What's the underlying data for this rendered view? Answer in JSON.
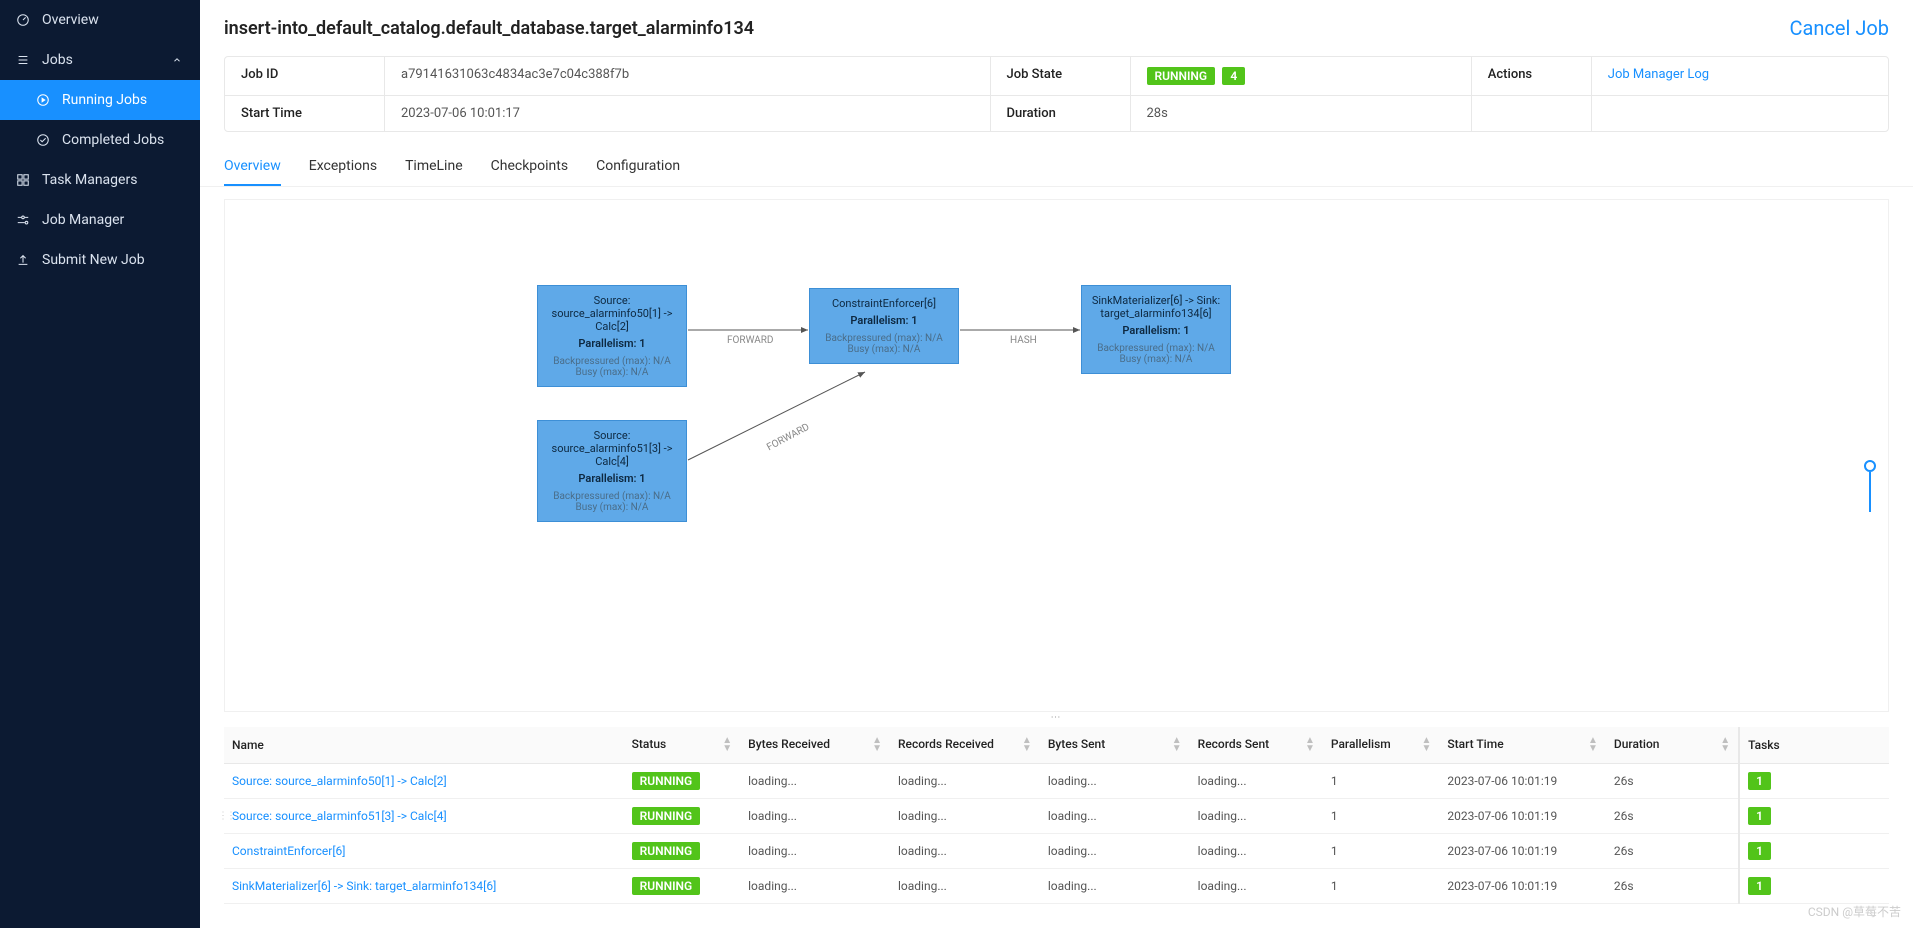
{
  "sidebar": {
    "overview": "Overview",
    "jobs": "Jobs",
    "running_jobs": "Running Jobs",
    "completed_jobs": "Completed Jobs",
    "task_managers": "Task Managers",
    "job_manager": "Job Manager",
    "submit_new_job": "Submit New Job"
  },
  "header": {
    "title": "insert-into_default_catalog.default_database.target_alarminfo134",
    "cancel": "Cancel Job"
  },
  "info": {
    "job_id_label": "Job ID",
    "job_id_value": "a79141631063c4834ac3e7c04c388f7b",
    "job_state_label": "Job State",
    "job_state_value": "RUNNING",
    "job_state_count": "4",
    "actions_label": "Actions",
    "actions_link": "Job Manager Log",
    "start_time_label": "Start Time",
    "start_time_value": "2023-07-06 10:01:17",
    "duration_label": "Duration",
    "duration_value": "28s"
  },
  "tabs": {
    "overview": "Overview",
    "exceptions": "Exceptions",
    "timeline": "TimeLine",
    "checkpoints": "Checkpoints",
    "configuration": "Configuration"
  },
  "graph": {
    "nodes": [
      {
        "title": "Source: source_alarminfo50[1] -> Calc[2]",
        "par": "Parallelism: 1",
        "bp": "Backpressured (max): N/A",
        "busy": "Busy (max): N/A"
      },
      {
        "title": "Source: source_alarminfo51[3] -> Calc[4]",
        "par": "Parallelism: 1",
        "bp": "Backpressured (max): N/A",
        "busy": "Busy (max): N/A"
      },
      {
        "title": "ConstraintEnforcer[6]",
        "par": "Parallelism: 1",
        "bp": "Backpressured (max): N/A",
        "busy": "Busy (max): N/A"
      },
      {
        "title": "SinkMaterializer[6] -> Sink: target_alarminfo134[6]",
        "par": "Parallelism: 1",
        "bp": "Backpressured (max): N/A",
        "busy": "Busy (max): N/A"
      }
    ],
    "edge1": "FORWARD",
    "edge2": "FORWARD",
    "edge3": "HASH"
  },
  "columns": {
    "name": "Name",
    "status": "Status",
    "bytes_received": "Bytes Received",
    "records_received": "Records Received",
    "bytes_sent": "Bytes Sent",
    "records_sent": "Records Sent",
    "parallelism": "Parallelism",
    "start_time": "Start Time",
    "duration": "Duration",
    "tasks": "Tasks"
  },
  "rows": [
    {
      "name": "Source: source_alarminfo50[1] -> Calc[2]",
      "status": "RUNNING",
      "br": "loading...",
      "rr": "loading...",
      "bs": "loading...",
      "rs": "loading...",
      "par": "1",
      "st": "2023-07-06 10:01:19",
      "dur": "26s",
      "tasks": "1"
    },
    {
      "name": "Source: source_alarminfo51[3] -> Calc[4]",
      "status": "RUNNING",
      "br": "loading...",
      "rr": "loading...",
      "bs": "loading...",
      "rs": "loading...",
      "par": "1",
      "st": "2023-07-06 10:01:19",
      "dur": "26s",
      "tasks": "1"
    },
    {
      "name": "ConstraintEnforcer[6]",
      "status": "RUNNING",
      "br": "loading...",
      "rr": "loading...",
      "bs": "loading...",
      "rs": "loading...",
      "par": "1",
      "st": "2023-07-06 10:01:19",
      "dur": "26s",
      "tasks": "1"
    },
    {
      "name": "SinkMaterializer[6] -> Sink: target_alarminfo134[6]",
      "status": "RUNNING",
      "br": "loading...",
      "rr": "loading...",
      "bs": "loading...",
      "rs": "loading...",
      "par": "1",
      "st": "2023-07-06 10:01:19",
      "dur": "26s",
      "tasks": "1"
    }
  ],
  "watermark": "CSDN @草莓不苦"
}
